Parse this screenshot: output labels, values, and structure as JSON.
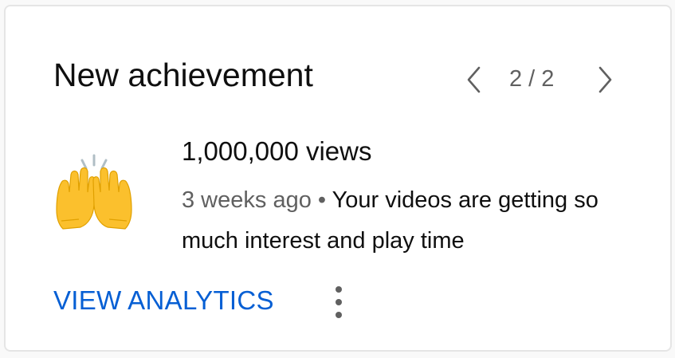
{
  "card": {
    "title": "New achievement",
    "pager": {
      "prev_icon": "chevron-left-icon",
      "next_icon": "chevron-right-icon",
      "count": "2 / 2"
    },
    "achievement": {
      "icon": "raising-hands-emoji",
      "title": "1,000,000 views",
      "time": "3 weeks ago",
      "separator": " • ",
      "description": "Your videos are getting so much interest and play time"
    },
    "action_label": "VIEW ANALYTICS",
    "more_icon": "more-vertical-icon"
  },
  "colors": {
    "accent": "#065fd4",
    "secondary_text": "#606060",
    "primary_text": "#0f0f0f",
    "emoji_yellow": "#fbc02d"
  }
}
